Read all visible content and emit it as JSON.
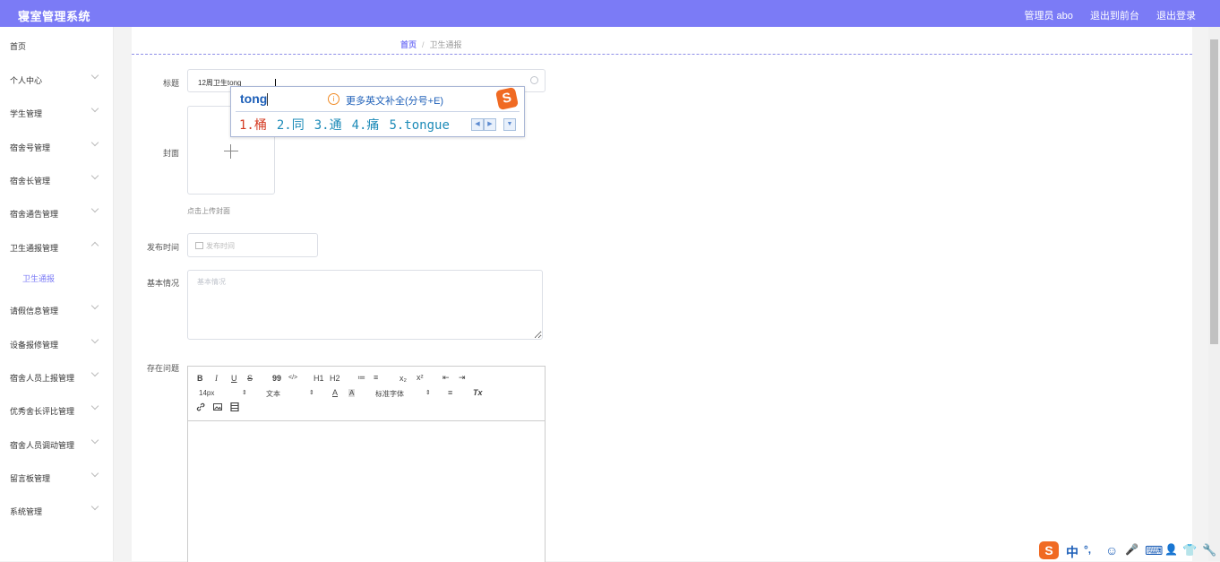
{
  "app": {
    "title": "寝室管理系统"
  },
  "header": {
    "user_label": "管理员 abo",
    "front_link": "退出到前台",
    "logout_link": "退出登录"
  },
  "sidebar": {
    "items": [
      {
        "label": "首页"
      },
      {
        "label": "个人中心"
      },
      {
        "label": "学生管理"
      },
      {
        "label": "宿舍号管理"
      },
      {
        "label": "宿舍长管理"
      },
      {
        "label": "宿舍通告管理"
      },
      {
        "label": "卫生通报管理"
      },
      {
        "label": "卫生通报"
      },
      {
        "label": "请假信息管理"
      },
      {
        "label": "设备报修管理"
      },
      {
        "label": "宿舍人员上报管理"
      },
      {
        "label": "优秀舍长评比管理"
      },
      {
        "label": "宿舍人员调动管理"
      },
      {
        "label": "留言板管理"
      },
      {
        "label": "系统管理"
      }
    ]
  },
  "breadcrumb": {
    "home": "首页",
    "separator": "/",
    "current": "卫生通报"
  },
  "form": {
    "title_label": "标题",
    "title_value": "12周卫生tong",
    "cover_label": "封面",
    "cover_hint": "点击上传封面",
    "publish_label": "发布时间",
    "publish_placeholder": "发布时间",
    "basic_label": "基本情况",
    "basic_placeholder": "基本情况",
    "issues_label": "存在问题"
  },
  "editor": {
    "bold": "B",
    "italic": "I",
    "underline": "U",
    "strike": "S",
    "quote": "99",
    "code": "</>",
    "h1": "H1",
    "h2": "H2",
    "list_ordered": "≔",
    "list_bullet": "≡",
    "sub": "x₂",
    "sup": "x²",
    "outdent": "⇤",
    "indent": "⇥",
    "size": "14px",
    "header": "文本",
    "color": "A",
    "background": "A",
    "font": "标准字体",
    "align": "≡",
    "clean": "Tx"
  },
  "ime": {
    "input": "tong",
    "tip": "更多英文补全(分号+E)",
    "candidates": [
      "1.桶",
      "2.同",
      "3.通",
      "4.痛",
      "5.tongue"
    ]
  },
  "imebar": {
    "items": [
      "S",
      "中",
      "°,",
      "☺",
      "🎤",
      "⌨",
      "👤",
      "👕",
      "🔧"
    ]
  },
  "colors": {
    "accent": "#7b7bf6",
    "ime_blue": "#1d5fb8",
    "ime_red": "#d43a22",
    "sogou_orange": "#f06a23"
  }
}
